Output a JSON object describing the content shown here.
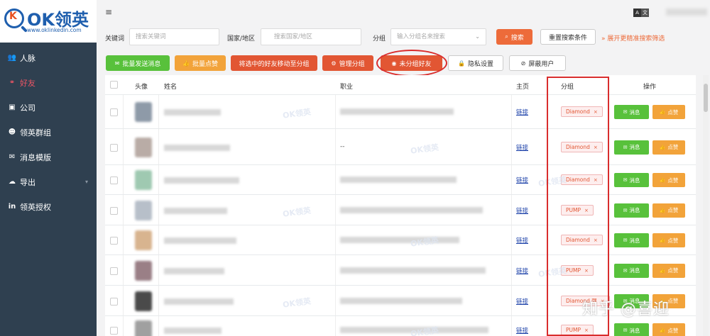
{
  "brand": {
    "logo_text": "OK领英",
    "url": "www.oklinkedin.com"
  },
  "sidebar": {
    "items": [
      {
        "label": "人脉",
        "icon": "users-icon"
      },
      {
        "label": "好友",
        "icon": "handshake-icon",
        "active": true
      },
      {
        "label": "公司",
        "icon": "briefcase-icon"
      },
      {
        "label": "领英群组",
        "icon": "group-icon"
      },
      {
        "label": "消息模版",
        "icon": "envelope-icon"
      },
      {
        "label": "导出",
        "icon": "cloud-download-icon",
        "has_submenu": true
      },
      {
        "label": "领英授权",
        "icon": "linkedin-icon"
      }
    ]
  },
  "topbar": {
    "lang_icon_left": "A",
    "lang_icon_right": "文"
  },
  "search": {
    "keyword_label": "关键词",
    "keyword_placeholder": "搜索关键词",
    "country_label": "国家/地区",
    "country_placeholder": "搜索国家/地区",
    "group_label": "分组",
    "group_placeholder": "输入分组名来搜索",
    "search_button": "搜索",
    "reset_button": "重置搜索条件",
    "expand_link": "展开更精准搜索筛选"
  },
  "actions": {
    "bulk_message": "批量发送消息",
    "bulk_like": "批量点赞",
    "move_to_group": "将选中的好友移动至分组",
    "manage_groups": "管理分组",
    "ungrouped_friends": "未分组好友",
    "privacy_settings": "隐私设置",
    "blocked_users": "屏蔽用户"
  },
  "table": {
    "headers": {
      "avatar": "头像",
      "name": "姓名",
      "job": "职业",
      "homepage": "主页",
      "group": "分组",
      "operation": "操作"
    },
    "link_text": "链接",
    "message_button": "消息",
    "like_button": "点赞",
    "rows": [
      {
        "job": "",
        "group": "Diamond",
        "avatar_color": "#8e9aa8"
      },
      {
        "job": "--",
        "group": "Diamond",
        "avatar_color": "#b9aca6"
      },
      {
        "job": "",
        "group": "Diamond",
        "avatar_color": "#9fc9b1"
      },
      {
        "job": "",
        "group": "PUMP",
        "avatar_color": "#b7bfc9"
      },
      {
        "job": "",
        "group": "Diamond",
        "avatar_color": "#d8b48f"
      },
      {
        "job": "",
        "group": "PUMP",
        "avatar_color": "#9a7f86"
      },
      {
        "job": "",
        "group": "Diamond 强",
        "avatar_color": "#4a4a4a"
      },
      {
        "job": "",
        "group": "PUMP",
        "avatar_color": "#a0a0a0"
      }
    ]
  },
  "watermark": {
    "site": "OK领英",
    "zhihu": "知乎 @喜迎"
  }
}
